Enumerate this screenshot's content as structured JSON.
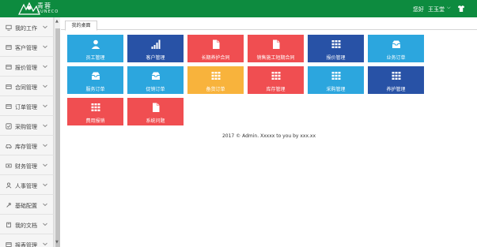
{
  "header": {
    "brand": "青蓉",
    "brand_sub": "SUNECO",
    "greeting": "您好",
    "username": "王玉堂",
    "colors": {
      "brand": "#0d8b3f"
    }
  },
  "sidebar": {
    "items": [
      {
        "label": "我的工作",
        "icon": "monitor-icon"
      },
      {
        "label": "客户管理",
        "icon": "card-icon"
      },
      {
        "label": "报价管理",
        "icon": "card-icon"
      },
      {
        "label": "合同管理",
        "icon": "card-icon"
      },
      {
        "label": "订单管理",
        "icon": "card-icon"
      },
      {
        "label": "采购管理",
        "icon": "check-icon"
      },
      {
        "label": "库存管理",
        "icon": "car-icon"
      },
      {
        "label": "财务管理",
        "icon": "money-icon"
      },
      {
        "label": "人事管理",
        "icon": "user-icon"
      },
      {
        "label": "基础配置",
        "icon": "wrench-icon"
      },
      {
        "label": "我的文档",
        "icon": "book-icon"
      },
      {
        "label": "报表管理",
        "icon": "card-icon"
      }
    ]
  },
  "tabs": {
    "home": "我的桌面"
  },
  "tiles": [
    {
      "label": "员工管理",
      "icon": "user-icon",
      "color": "#2ca6de"
    },
    {
      "label": "客户管理",
      "icon": "signal-icon",
      "color": "#2852a6"
    },
    {
      "label": "长期养护合同",
      "icon": "file-icon",
      "color": "#f04e51"
    },
    {
      "label": "销售施工短期合同",
      "icon": "file-icon",
      "color": "#f04e51"
    },
    {
      "label": "报价管理",
      "icon": "grid-icon",
      "color": "#2852a6"
    },
    {
      "label": "业务订单",
      "icon": "inbox-icon",
      "color": "#2ca6de"
    },
    {
      "label": "服务订单",
      "icon": "inbox-icon",
      "color": "#2ca6de"
    },
    {
      "label": "促销订单",
      "icon": "inbox-icon",
      "color": "#2ca6de"
    },
    {
      "label": "备货订单",
      "icon": "grid-icon",
      "color": "#f8b33c"
    },
    {
      "label": "库存管理",
      "icon": "grid-icon",
      "color": "#f04e51"
    },
    {
      "label": "采购管理",
      "icon": "grid-icon",
      "color": "#2ca6de"
    },
    {
      "label": "养护管理",
      "icon": "grid-icon",
      "color": "#2852a6"
    },
    {
      "label": "费用报销",
      "icon": "grid-icon",
      "color": "#f04e51"
    },
    {
      "label": "系统问题",
      "icon": "file-icon",
      "color": "#f04e51"
    }
  ],
  "footer": {
    "text": "2017 © Admin. Xxxxx to you by xxx.xx"
  }
}
